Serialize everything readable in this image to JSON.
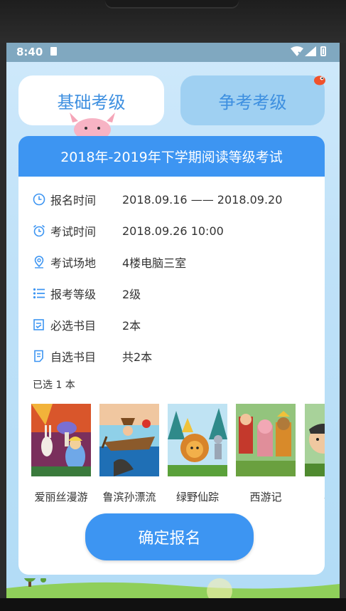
{
  "status_bar": {
    "time": "8:40"
  },
  "tabs": {
    "basic": "基础考级",
    "compete": "争考考级"
  },
  "card": {
    "title": "2018年-2019年下学期阅读等级考试",
    "rows": [
      {
        "icon": "clock-icon",
        "label": "报名时间",
        "value": "2018.09.16 —— 2018.09.20"
      },
      {
        "icon": "alarm-clock-icon",
        "label": "考试时间",
        "value": "2018.09.26 10:00"
      },
      {
        "icon": "location-pin-icon",
        "label": "考试场地",
        "value": "4楼电脑三室"
      },
      {
        "icon": "list-icon",
        "label": "报考等级",
        "value": "2级"
      },
      {
        "icon": "checklist-icon",
        "label": "必选书目",
        "value": "2本"
      },
      {
        "icon": "document-icon",
        "label": "自选书目",
        "value": "共2本"
      }
    ],
    "selected_count": "已选 1 本",
    "books": [
      {
        "title": "爱丽丝漫游"
      },
      {
        "title": "鲁滨孙漂流"
      },
      {
        "title": "绿野仙踪"
      },
      {
        "title": "西游记"
      },
      {
        "title": "农夫"
      }
    ],
    "confirm_button": "确定报名"
  },
  "colors": {
    "primary": "#3d95f2",
    "tab_inactive": "#9fd0f2",
    "background": "#c5e5f9"
  }
}
